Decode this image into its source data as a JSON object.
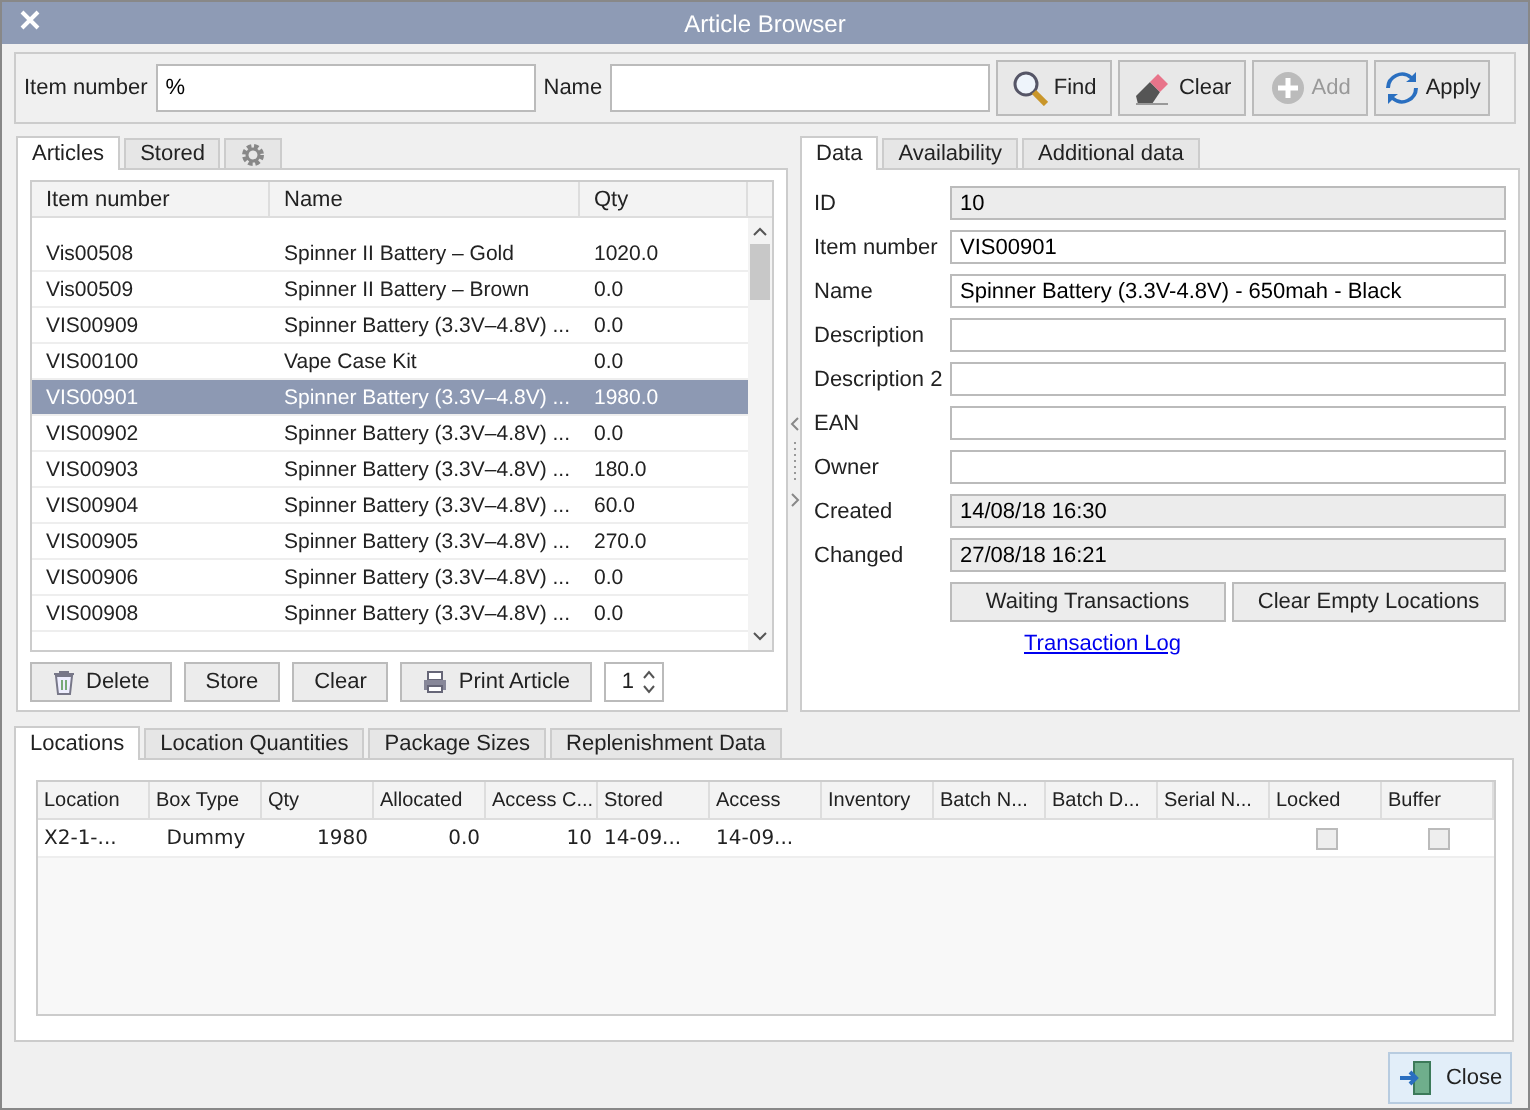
{
  "window": {
    "title": "Article Browser"
  },
  "search": {
    "item_number": {
      "label": "Item number",
      "value": "%"
    },
    "name": {
      "label": "Name"
    }
  },
  "toolbar_buttons": [
    {
      "label": "Find",
      "disabled": false
    },
    {
      "label": "Clear",
      "disabled": false
    },
    {
      "label": "Add",
      "disabled": true
    },
    {
      "label": "Apply",
      "disabled": false
    }
  ],
  "article_tabs": [
    {
      "kind": "text",
      "label": "Articles",
      "selected": true
    },
    {
      "kind": "text",
      "label": "Stored",
      "selected": false
    },
    {
      "kind": "gear",
      "selected": false
    }
  ],
  "articles": {
    "columns": [
      "Item number",
      "Name",
      "Qty"
    ],
    "rows": [
      {
        "cells": [
          "Vis00508",
          "Spinner II Battery – Gold",
          "1020.0"
        ],
        "selected": false
      },
      {
        "cells": [
          "Vis00509",
          "Spinner II Battery – Brown",
          "0.0"
        ],
        "selected": false
      },
      {
        "cells": [
          "VIS00909",
          "Spinner Battery (3.3V–4.8V) ...",
          "0.0"
        ],
        "selected": false
      },
      {
        "cells": [
          "VIS00100",
          "Vape Case Kit",
          "0.0"
        ],
        "selected": false
      },
      {
        "cells": [
          "VIS00901",
          "Spinner Battery (3.3V–4.8V) ...",
          "1980.0"
        ],
        "selected": true
      },
      {
        "cells": [
          "VIS00902",
          "Spinner Battery (3.3V–4.8V) ...",
          "0.0"
        ],
        "selected": false
      },
      {
        "cells": [
          "VIS00903",
          "Spinner Battery (3.3V–4.8V) ...",
          "180.0"
        ],
        "selected": false
      },
      {
        "cells": [
          "VIS00904",
          "Spinner Battery (3.3V–4.8V) ...",
          "60.0"
        ],
        "selected": false
      },
      {
        "cells": [
          "VIS00905",
          "Spinner Battery (3.3V–4.8V) ...",
          "270.0"
        ],
        "selected": false
      },
      {
        "cells": [
          "VIS00906",
          "Spinner Battery (3.3V–4.8V) ...",
          "0.0"
        ],
        "selected": false
      },
      {
        "cells": [
          "VIS00908",
          "Spinner Battery (3.3V–4.8V) ...",
          "0.0"
        ],
        "selected": false
      }
    ]
  },
  "article_actions": [
    {
      "label": "Delete"
    },
    {
      "label": "Store"
    },
    {
      "label": "Clear"
    },
    {
      "label": "Print Article"
    }
  ],
  "copies": {
    "value": "1"
  },
  "detail_tabs": [
    {
      "label": "Data",
      "selected": true
    },
    {
      "label": "Availability",
      "selected": false
    },
    {
      "label": "Additional data",
      "selected": false
    }
  ],
  "fields": [
    {
      "label": "ID",
      "value": "10",
      "readonly": true
    },
    {
      "label": "Item number",
      "value": "VIS00901",
      "readonly": false
    },
    {
      "label": "Name",
      "value": "Spinner Battery (3.3V-4.8V) - 650mah - Black",
      "readonly": false
    },
    {
      "label": "Description",
      "readonly": false
    },
    {
      "label": "Description 2",
      "readonly": false
    },
    {
      "label": "EAN",
      "readonly": false
    },
    {
      "label": "Owner",
      "readonly": false
    },
    {
      "label": "Created",
      "value": "14/08/18 16:30",
      "readonly": true
    },
    {
      "label": "Changed",
      "value": "27/08/18 16:21",
      "readonly": true
    }
  ],
  "detail_buttons": [
    "Waiting Transactions",
    "Clear Empty Locations"
  ],
  "detail_link": "Transaction Log",
  "location_tabs": [
    {
      "label": "Locations",
      "selected": true
    },
    {
      "label": "Location Quantities",
      "selected": false
    },
    {
      "label": "Package Sizes",
      "selected": false
    },
    {
      "label": "Replenishment Data",
      "selected": false
    }
  ],
  "locations": {
    "columns": [
      "Location",
      "Box Type",
      "Qty",
      "Allocated",
      "Access C...",
      "Stored",
      "Access",
      "Inventory",
      "Batch N...",
      "Batch D...",
      "Serial N...",
      "Locked",
      "Buffer"
    ],
    "rows": [
      {
        "cells": [
          "X2-1-...",
          "Dummy",
          "1980",
          "0.0",
          "10",
          "14-09...",
          "14-09..."
        ],
        "locked": false,
        "buffer": false
      }
    ]
  },
  "close_button": {
    "label": "Close"
  }
}
